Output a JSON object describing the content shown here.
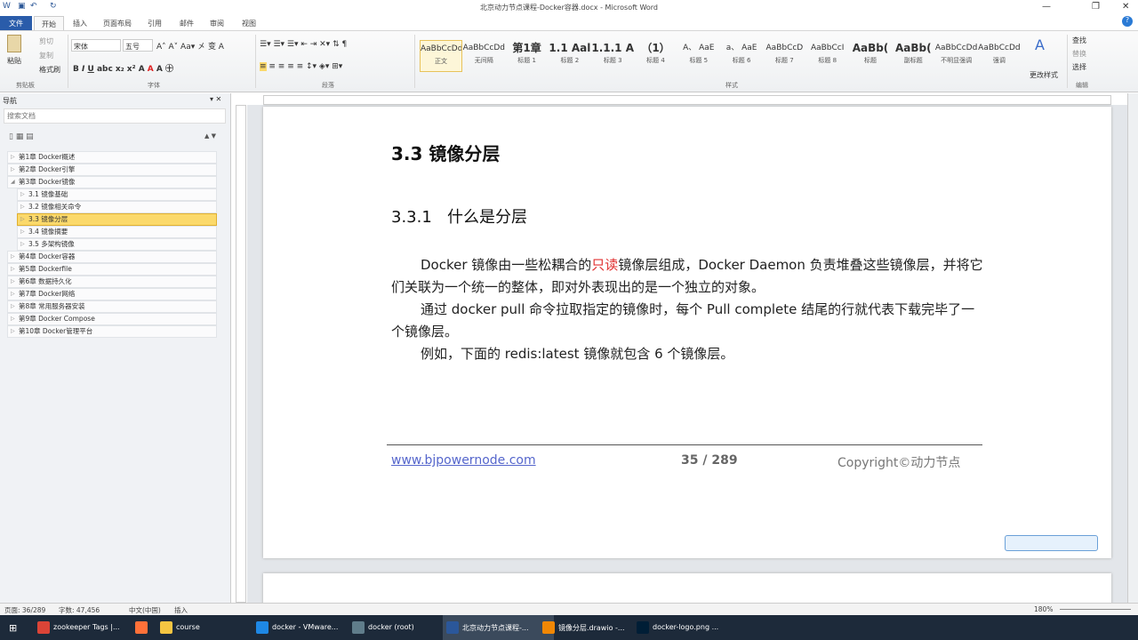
{
  "window": {
    "title": "北京动力节点课程-Docker容器.docx - Microsoft Word"
  },
  "tabs": [
    "文件",
    "开始",
    "插入",
    "页面布局",
    "引用",
    "邮件",
    "审阅",
    "视图"
  ],
  "ribbon": {
    "clipboard": {
      "paste": "粘贴",
      "cut": "剪切",
      "copy": "复制",
      "format_painter": "格式刷",
      "label": "剪贴板"
    },
    "font": {
      "name": "宋体",
      "size": "五号",
      "label": "字体"
    },
    "paragraph": {
      "label": "段落"
    },
    "styles": {
      "label": "样式",
      "items": [
        {
          "preview": "AaBbCcDd",
          "name": "正文"
        },
        {
          "preview": "AaBbCcDd",
          "name": "无间隔"
        },
        {
          "preview": "第1章",
          "name": "标题 1"
        },
        {
          "preview": "1.1 Aal",
          "name": "标题 2"
        },
        {
          "preview": "1.1.1 A",
          "name": "标题 3"
        },
        {
          "preview": "（1）",
          "name": "标题 4"
        },
        {
          "preview": "A、 AaE",
          "name": "标题 5"
        },
        {
          "preview": "a、 AaE",
          "name": "标题 6"
        },
        {
          "preview": "AaBbCcD",
          "name": "标题 7"
        },
        {
          "preview": "AaBbCcI",
          "name": "标题 8"
        },
        {
          "preview": "AaBb(",
          "name": "标题"
        },
        {
          "preview": "AaBb(",
          "name": "副标题"
        },
        {
          "preview": "AaBbCcDd",
          "name": "不明显强调"
        },
        {
          "preview": "AaBbCcDd",
          "name": "强调"
        }
      ],
      "change_styles": "更改样式"
    },
    "editing": {
      "find": "查找",
      "replace": "替换",
      "select": "选择",
      "label": "编辑"
    }
  },
  "nav": {
    "title": "导航",
    "search_placeholder": "搜索文档",
    "items": [
      {
        "label": "第1章 Docker概述",
        "level": 1
      },
      {
        "label": "第2章  Docker引擎",
        "level": 1
      },
      {
        "label": "第3章 Docker镜像",
        "level": 1,
        "expanded": true
      },
      {
        "label": "3.1 镜像基础",
        "level": 2
      },
      {
        "label": "3.2 镜像相关命令",
        "level": 2
      },
      {
        "label": "3.3 镜像分层",
        "level": 2,
        "selected": true
      },
      {
        "label": "3.4 镜像摘要",
        "level": 2
      },
      {
        "label": "3.5 多架构镜像",
        "level": 2
      },
      {
        "label": "第4章 Docker容器",
        "level": 1
      },
      {
        "label": "第5章 Dockerfile",
        "level": 1
      },
      {
        "label": "第6章 数据持久化",
        "level": 1
      },
      {
        "label": "第7章 Docker网络",
        "level": 1
      },
      {
        "label": "第8章 常用服务器安装",
        "level": 1
      },
      {
        "label": "第9章 Docker Compose",
        "level": 1
      },
      {
        "label": "第10章 Docker管理平台",
        "level": 1
      }
    ]
  },
  "doc": {
    "h1": "3.3 镜像分层",
    "h2_num": "3.3.1",
    "h2_text": "什么是分层",
    "p1_a": "Docker 镜像由一些松耦合的",
    "p1_red": "只读",
    "p1_b": "镜像层组成，Docker Daemon 负责堆叠这些镜像层，并将它们关联为一个统一的整体，即对外表现出的是一个独立的对象。",
    "p2": "通过 docker pull 命令拉取指定的镜像时，每个 Pull complete 结尾的行就代表下载完毕了一个镜像层。",
    "p3": "例如，下面的 redis:latest 镜像就包含 6 个镜像层。",
    "footer_link": "www.bjpowernode.com",
    "footer_page": "35 / 289",
    "footer_copy": "Copyright©动力节点"
  },
  "status": {
    "page": "页面: 36/289",
    "words": "字数: 47,456",
    "lang": "中文(中国)",
    "mode": "插入",
    "zoom": "180%"
  },
  "taskbar": [
    {
      "label": "zookeeper Tags |...",
      "color": "#db4437"
    },
    {
      "label": "",
      "color": "#ff7139"
    },
    {
      "label": "course",
      "color": "#f4c542"
    },
    {
      "label": "docker - VMware...",
      "color": "#1e88e5"
    },
    {
      "label": "docker (root)",
      "color": "#607d8b"
    },
    {
      "label": "北京动力节点课程-...",
      "color": "#2b579a",
      "active": true
    },
    {
      "label": "镜像分层.drawio -...",
      "color": "#f08705"
    },
    {
      "label": "docker-logo.png ...",
      "color": "#001e36"
    }
  ]
}
